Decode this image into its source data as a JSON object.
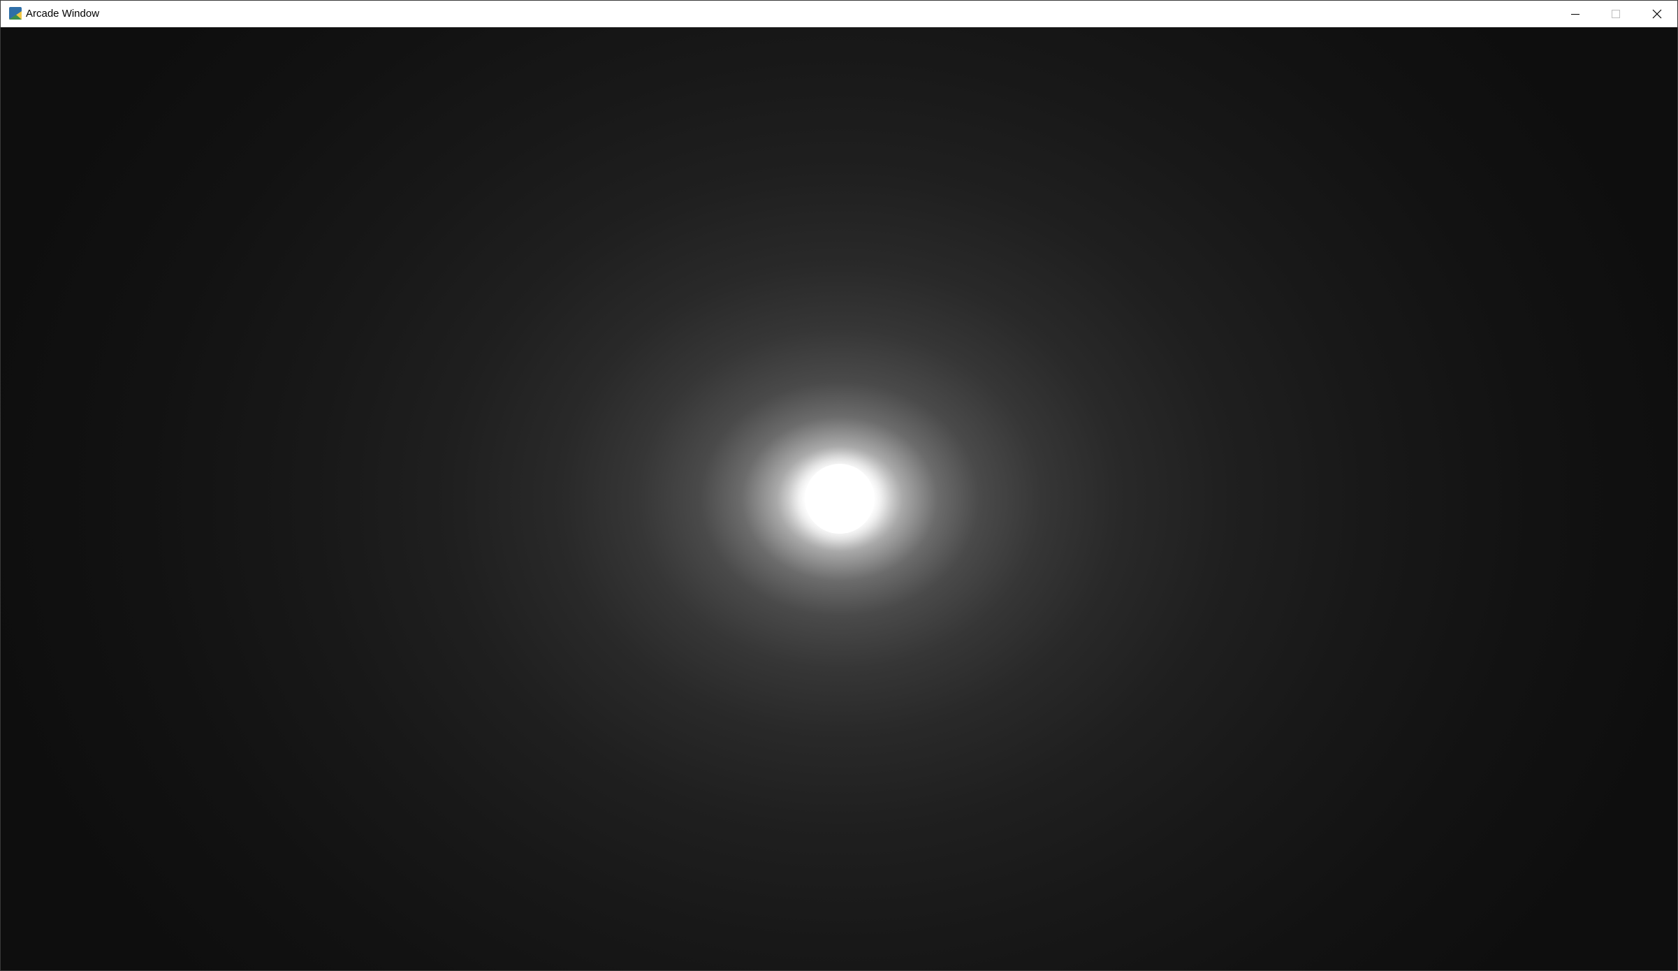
{
  "window": {
    "title": "Arcade Window",
    "icon": "python-arcade-icon",
    "controls": {
      "minimize_icon": "minimize-icon",
      "maximize_icon": "maximize-icon",
      "close_icon": "close-icon"
    }
  },
  "scene": {
    "background_color": "#0d0d0d",
    "light_color": "#ffffff"
  }
}
